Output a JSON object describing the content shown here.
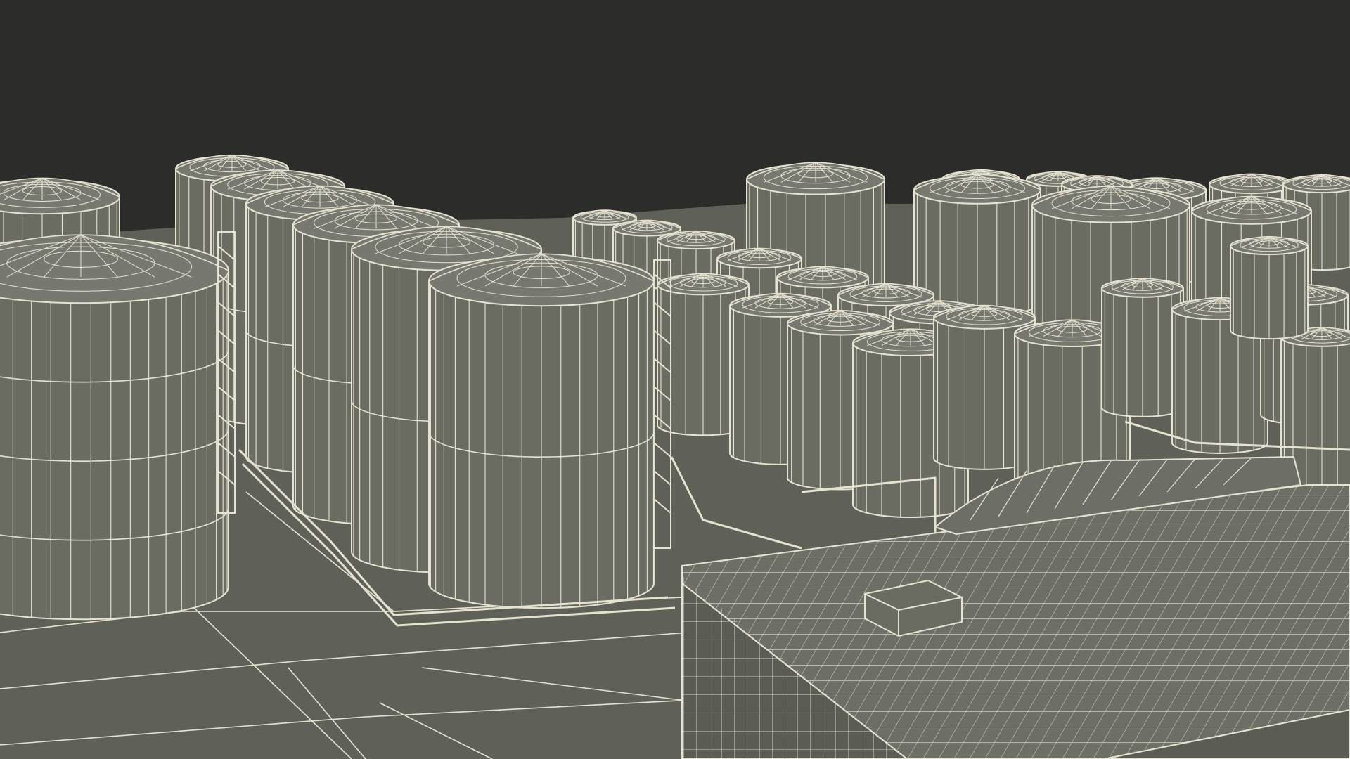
{
  "scene": {
    "subject": "wireframe-render",
    "colors": {
      "background": "#2c2d2b",
      "ground": "#5f6158",
      "ground_dark": "#56584f",
      "tank_body": "#6a6c62",
      "tank_shade": "#5a5c53",
      "roof": "#777970",
      "wire": "#e6e2d2",
      "building_top": "#6d6f66",
      "building_side": "#5b5d54"
    },
    "icons": {
      "tank": "cylinder-tank-icon",
      "building": "warehouse-icon"
    }
  }
}
